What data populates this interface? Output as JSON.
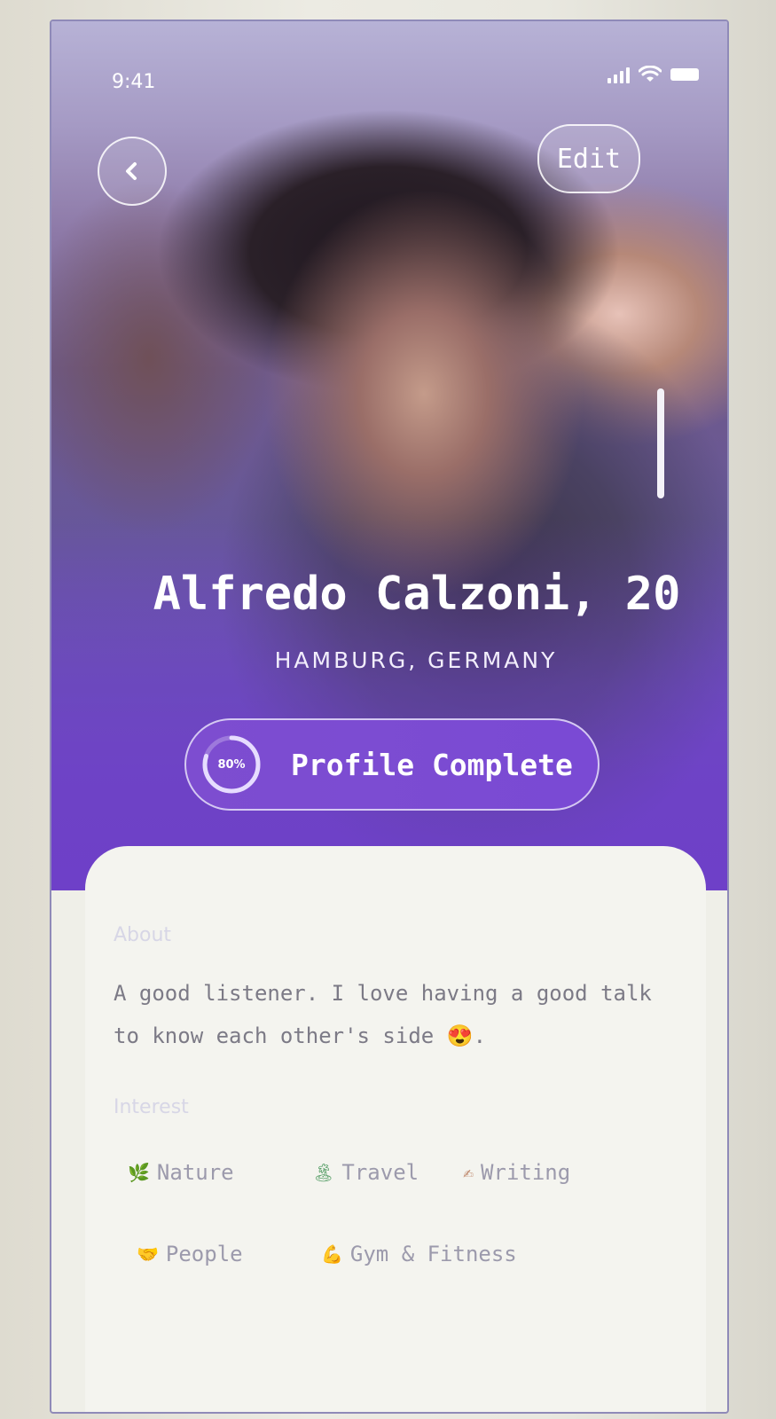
{
  "status_bar": {
    "time": "9:41"
  },
  "header": {
    "back_icon": "chevron-left-icon",
    "edit_label": "Edit"
  },
  "profile": {
    "name": "Alfredo Calzoni, 20",
    "location": "HAMBURG, GERMANY",
    "completion_label": "Profile Complete",
    "completion_percent_text": "80%",
    "completion_fraction": 0.8
  },
  "about": {
    "title": "About",
    "text_line1": "A good listener. I love having a good talk",
    "text_line2": "to know each other's side",
    "emoji": "😍",
    "text_end": "."
  },
  "interest": {
    "title": "Interest",
    "items": [
      {
        "label": "Nature",
        "icon": "🌿",
        "icon_name": "leaf-icon",
        "color": "#4f9a3a"
      },
      {
        "label": "Travel",
        "icon": "🏝",
        "icon_name": "palm-tree-icon",
        "color": "#5aa06a"
      },
      {
        "label": "Writing",
        "icon": "✍",
        "icon_name": "pencil-icon",
        "color": "#c08b70"
      },
      {
        "label": "People",
        "icon": "🤝",
        "icon_name": "handshake-icon",
        "color": "#e3a63c"
      },
      {
        "label": "Gym & Fitness",
        "icon": "💪",
        "icon_name": "flexed-arm-icon",
        "color": "#e2a845"
      }
    ]
  },
  "colors": {
    "accent": "#7a4ad4",
    "card_bg": "#f4f4ef",
    "muted_text": "#9c9aac"
  }
}
